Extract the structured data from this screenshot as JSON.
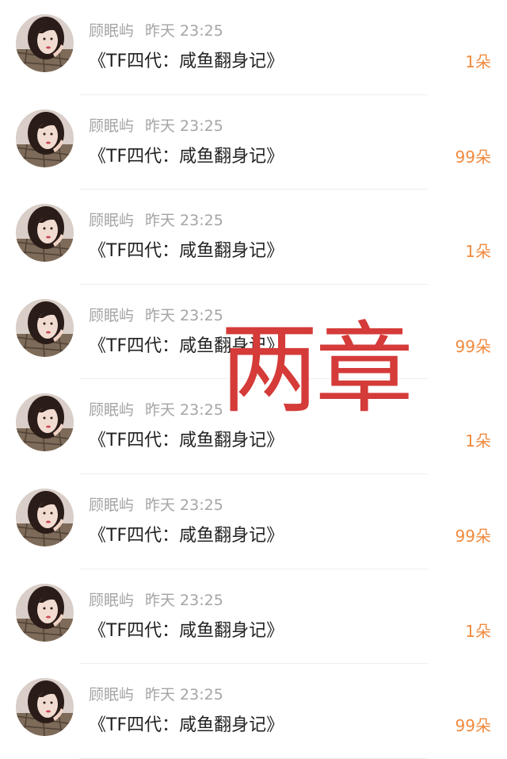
{
  "colors": {
    "name": "#a5a5a5",
    "title": "#222222",
    "amount": "#f08a3f",
    "overlay": "#d43b39"
  },
  "overlay_text": "两章",
  "items": [
    {
      "name": "顾眠屿",
      "time": "昨天 23:25",
      "title": "《TF四代：咸鱼翻身记》",
      "amount": "1朵"
    },
    {
      "name": "顾眠屿",
      "time": "昨天 23:25",
      "title": "《TF四代：咸鱼翻身记》",
      "amount": "99朵"
    },
    {
      "name": "顾眠屿",
      "time": "昨天 23:25",
      "title": "《TF四代：咸鱼翻身记》",
      "amount": "1朵"
    },
    {
      "name": "顾眠屿",
      "time": "昨天 23:25",
      "title": "《TF四代：咸鱼翻身记》",
      "amount": "99朵"
    },
    {
      "name": "顾眠屿",
      "time": "昨天 23:25",
      "title": "《TF四代：咸鱼翻身记》",
      "amount": "1朵"
    },
    {
      "name": "顾眠屿",
      "time": "昨天 23:25",
      "title": "《TF四代：咸鱼翻身记》",
      "amount": "99朵"
    },
    {
      "name": "顾眠屿",
      "time": "昨天 23:25",
      "title": "《TF四代：咸鱼翻身记》",
      "amount": "1朵"
    },
    {
      "name": "顾眠屿",
      "time": "昨天 23:25",
      "title": "《TF四代：咸鱼翻身记》",
      "amount": "99朵"
    }
  ]
}
